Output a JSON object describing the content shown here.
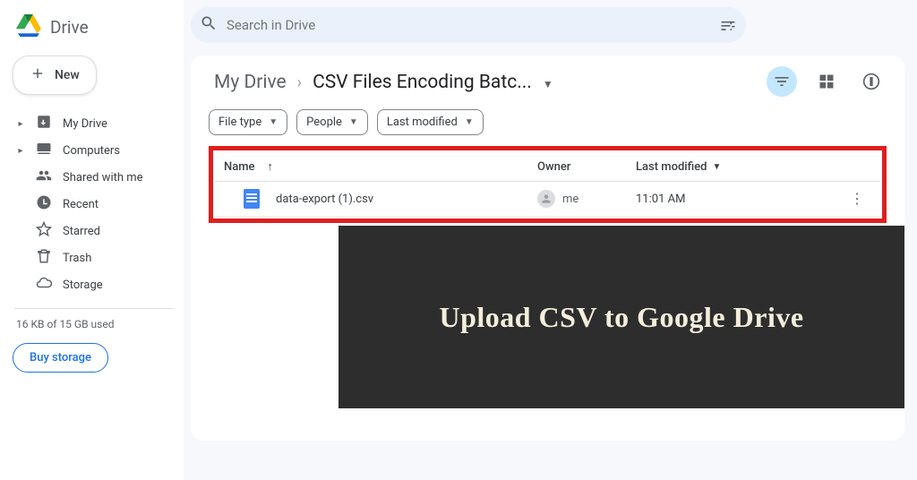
{
  "brand": {
    "name": "Drive"
  },
  "new_button": "New",
  "sidebar": {
    "items": [
      {
        "label": "My Drive",
        "expandable": true
      },
      {
        "label": "Computers",
        "expandable": true
      },
      {
        "label": "Shared with me",
        "expandable": false
      },
      {
        "label": "Recent",
        "expandable": false
      },
      {
        "label": "Starred",
        "expandable": false
      },
      {
        "label": "Trash",
        "expandable": false
      },
      {
        "label": "Storage",
        "expandable": false
      }
    ],
    "storage_used": "16 KB of 15 GB used",
    "buy_label": "Buy storage"
  },
  "search": {
    "placeholder": "Search in Drive"
  },
  "breadcrumb": {
    "root": "My Drive",
    "current": "CSV Files Encoding Batc..."
  },
  "filters": {
    "type": "File type",
    "people": "People",
    "modified": "Last modified"
  },
  "table": {
    "headers": {
      "name": "Name",
      "owner": "Owner",
      "modified": "Last modified"
    },
    "rows": [
      {
        "filename": "data-export (1).csv",
        "owner": "me",
        "modified": "11:01 AM"
      }
    ]
  },
  "overlay": {
    "caption": "Upload CSV to Google Drive"
  }
}
